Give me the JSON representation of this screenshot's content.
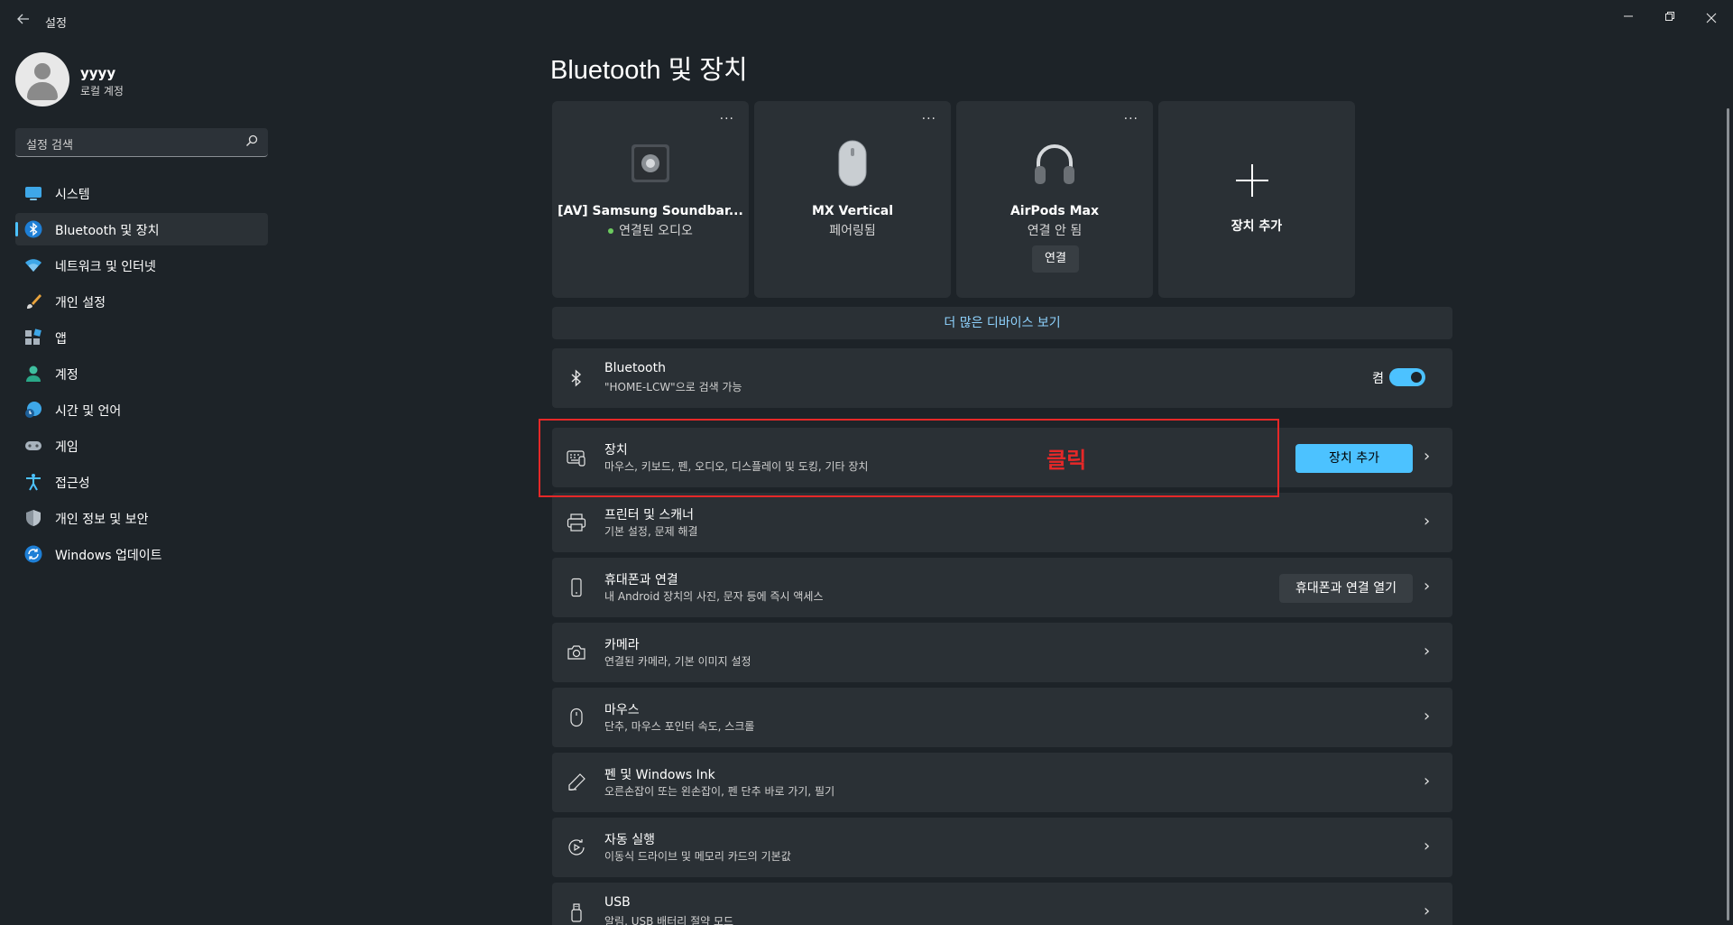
{
  "window": {
    "title": "설정",
    "back_icon": "arrow-left-icon",
    "controls": {
      "minimize": "—",
      "maximize": "❐",
      "close": "✕"
    }
  },
  "profile": {
    "name": "yyyy",
    "account_type": "로컬 계정"
  },
  "search": {
    "placeholder": "설정 검색"
  },
  "nav": [
    {
      "label": "시스템",
      "icon": "monitor-icon"
    },
    {
      "label": "Bluetooth 및 장치",
      "icon": "bluetooth-icon",
      "active": true
    },
    {
      "label": "네트워크 및 인터넷",
      "icon": "wifi-icon"
    },
    {
      "label": "개인 설정",
      "icon": "brush-icon"
    },
    {
      "label": "앱",
      "icon": "apps-icon"
    },
    {
      "label": "계정",
      "icon": "person-icon"
    },
    {
      "label": "시간 및 언어",
      "icon": "globe-clock-icon"
    },
    {
      "label": "게임",
      "icon": "gamepad-icon"
    },
    {
      "label": "접근성",
      "icon": "accessibility-icon"
    },
    {
      "label": "개인 정보 및 보안",
      "icon": "shield-icon"
    },
    {
      "label": "Windows 업데이트",
      "icon": "update-icon"
    }
  ],
  "page_title": "Bluetooth 및 장치",
  "devices": [
    {
      "name": "[AV] Samsung Soundbar...",
      "status": "연결된 오디오",
      "icon": "speaker-icon",
      "more": "..."
    },
    {
      "name": "MX Vertical",
      "status": "페어링됨",
      "icon": "mouse-icon",
      "more": "..."
    },
    {
      "name": "AirPods Max",
      "status": "연결 안 됨",
      "icon": "headphones-icon",
      "more": "...",
      "connect_label": "연결"
    }
  ],
  "add_device_card": {
    "label": "장치 추가",
    "icon": "plus-icon"
  },
  "more_devices_link": "더 많은 디바이스 보기",
  "bluetooth_row": {
    "title": "Bluetooth",
    "subtitle": "\"HOME-LCW\"으로 검색 가능",
    "state_label": "켬",
    "on": true
  },
  "rows": [
    {
      "title": "장치",
      "subtitle": "마우스, 키보드, 펜, 오디오, 디스플레이 및 도킹, 기타 장치",
      "icon": "devices-icon",
      "button": "장치 추가"
    },
    {
      "title": "프린터 및 스캐너",
      "subtitle": "기본 설정, 문제 해결",
      "icon": "printer-icon"
    },
    {
      "title": "휴대폰과 연결",
      "subtitle": "내 Android 장치의 사진, 문자 등에 즉시 액세스",
      "icon": "phone-icon",
      "button": "휴대폰과 연결 열기"
    },
    {
      "title": "카메라",
      "subtitle": "연결된 카메라, 기본 이미지 설정",
      "icon": "camera-icon"
    },
    {
      "title": "마우스",
      "subtitle": "단추, 마우스 포인터 속도, 스크롤",
      "icon": "mouse-outline-icon"
    },
    {
      "title": "펜 및 Windows Ink",
      "subtitle": "오른손잡이 또는 왼손잡이, 펜 단추 바로 가기, 필기",
      "icon": "pen-icon"
    },
    {
      "title": "자동 실행",
      "subtitle": "이동식 드라이브 및 메모리 카드의 기본값",
      "icon": "autoplay-icon"
    },
    {
      "title": "USB",
      "subtitle": "알림, USB 배터리 절약 모드",
      "icon": "usb-icon"
    }
  ],
  "chevron": "›",
  "annotation": {
    "text": "클릭",
    "color": "#e62828"
  },
  "colors": {
    "accent": "#4cc2ff",
    "background": "#1d2328",
    "card": "#2a3035",
    "connected_dot": "#6ccb5f"
  }
}
